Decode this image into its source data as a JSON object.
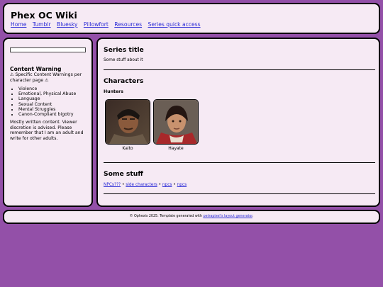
{
  "header": {
    "title": "Phex OC Wiki",
    "nav": [
      {
        "label": "Home"
      },
      {
        "label": "Tumblr"
      },
      {
        "label": "Bluesky"
      },
      {
        "label": "Pillowfort"
      },
      {
        "label": "Resources"
      },
      {
        "label": "Series quick access"
      }
    ]
  },
  "sidebar": {
    "content_warning": {
      "title": "Content Warning",
      "subtitle": "⚠ Specific Content Warnings per character page ⚠",
      "items": [
        "Violence",
        "Emotional, Physical Abuse",
        "Language",
        "Sexual Content",
        "Mental Struggles",
        "Canon-Compliant bigotry"
      ],
      "note": "Mostly written content. Viewer discretion is advised. Please remember that I am an adult and write for other adults."
    }
  },
  "main": {
    "series_title": "Series title",
    "series_desc": "Some stuff about it",
    "characters_title": "Characters",
    "group_label": "Hunters",
    "characters": [
      {
        "name": "Kaito"
      },
      {
        "name": "Hayate"
      }
    ],
    "stuff_title": "Some stuff",
    "links": [
      "NPCs???",
      "side characters",
      "npcs",
      "npcs"
    ],
    "separator": "•"
  },
  "footer": {
    "text_prefix": "© Ophexis 2025. Template generated with",
    "link": "petrapixel's layout generator",
    "text_suffix": "."
  }
}
